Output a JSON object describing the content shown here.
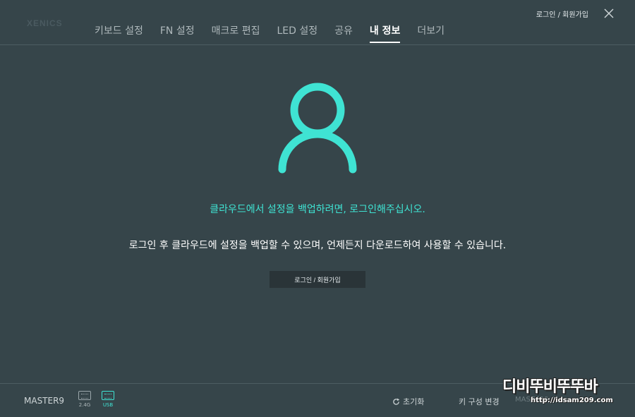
{
  "brand": "XENICS",
  "header": {
    "login_link": "로그인 / 회원가입"
  },
  "nav": {
    "tabs": [
      {
        "label": "키보드 설정",
        "active": false
      },
      {
        "label": "FN 설정",
        "active": false
      },
      {
        "label": "매크로 편집",
        "active": false
      },
      {
        "label": "LED 설정",
        "active": false
      },
      {
        "label": "공유",
        "active": false
      },
      {
        "label": "내 정보",
        "active": true
      },
      {
        "label": "더보기",
        "active": false
      }
    ]
  },
  "main": {
    "primary_message": "클라우드에서 설정을 백업하려면, 로그인해주십시오.",
    "secondary_message": "로그인 후 클라우드에 설정을 백업할 수 있으며, 언제든지 다운로드하여 사용할 수 있습니다.",
    "login_button": "로그인 / 회원가입"
  },
  "footer": {
    "device_name": "MASTER9",
    "connections": [
      {
        "label": "2.4G",
        "active": false
      },
      {
        "label": "USB",
        "active": true
      }
    ],
    "reset_label": "초기화",
    "key_config_label": "키 구성 변경",
    "key_config_value": "MASTER9_1"
  },
  "watermark": {
    "main": "디비뚜비뚜뚜바",
    "url": "http://idsam209.com"
  },
  "colors": {
    "background": "#36454a",
    "accent": "#3fe3d3",
    "button_bg": "#2a3438"
  }
}
